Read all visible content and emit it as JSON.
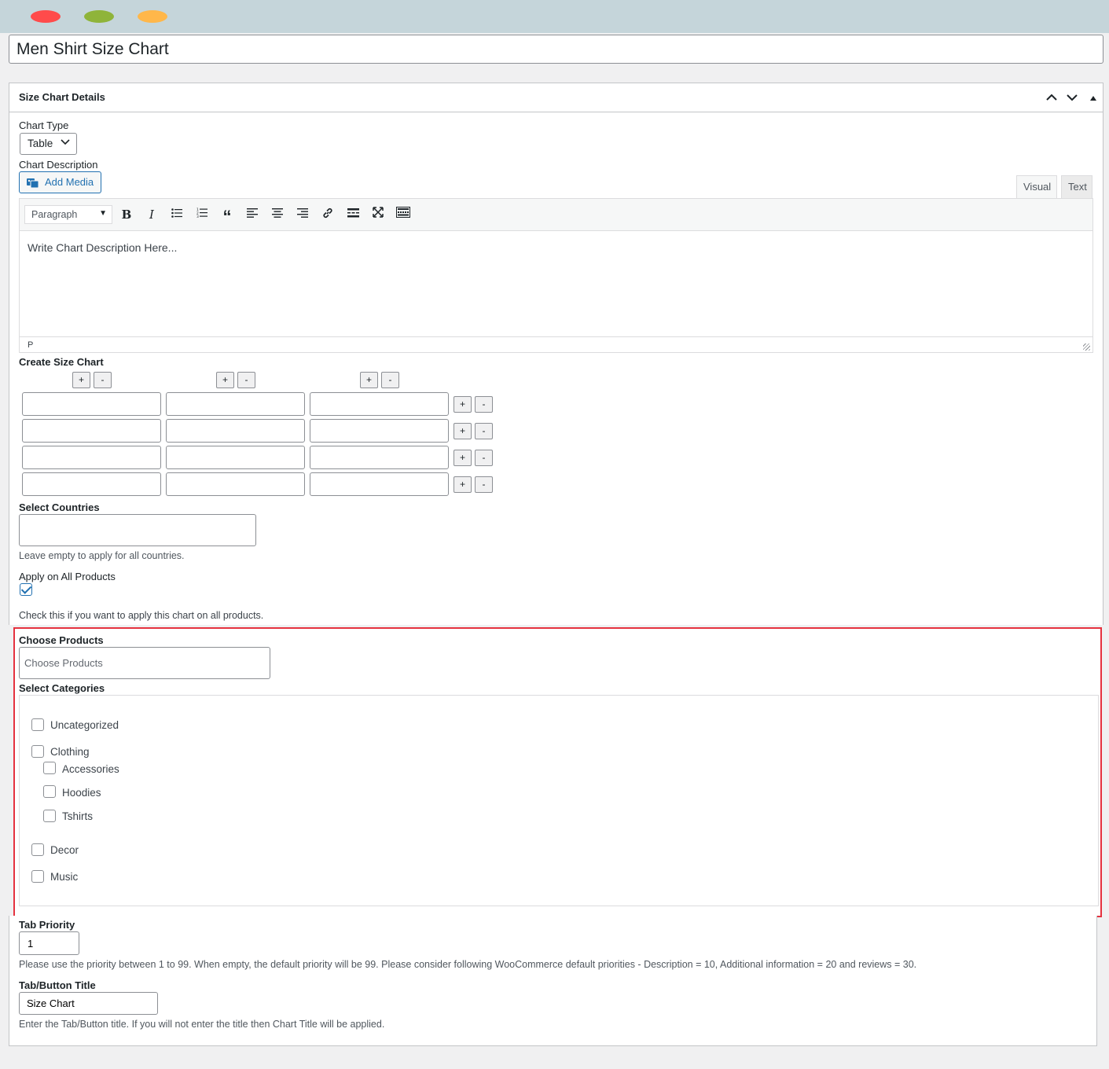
{
  "window": {
    "controls": [
      "close",
      "minimize",
      "maximize"
    ]
  },
  "post_title": "Men Shirt Size Chart",
  "metabox": {
    "title": "Size Chart Details",
    "header_buttons": [
      "chevron-up-icon",
      "chevron-down-icon",
      "triangle-up-icon"
    ]
  },
  "chart_type": {
    "label": "Chart Type",
    "selected": "Table"
  },
  "chart_description": {
    "label": "Chart Description",
    "add_media_label": "Add Media",
    "tabs": {
      "visual": "Visual",
      "text": "Text"
    },
    "format_select": "Paragraph",
    "toolbar_icons": [
      "bold-icon",
      "italic-icon",
      "bullet-list-icon",
      "numbered-list-icon",
      "blockquote-icon",
      "align-left-icon",
      "align-center-icon",
      "align-right-icon",
      "link-icon",
      "read-more-icon",
      "fullscreen-icon",
      "toolbar-toggle-icon"
    ],
    "content": "Write Chart Description Here...",
    "path": "P"
  },
  "size_chart": {
    "label": "Create Size Chart",
    "columns": 3,
    "rows": [
      [
        "",
        "",
        ""
      ],
      [
        "",
        "",
        ""
      ],
      [
        "",
        "",
        ""
      ],
      [
        "",
        "",
        ""
      ]
    ],
    "plus": "+",
    "minus": "-"
  },
  "countries": {
    "label": "Select Countries",
    "value": "",
    "help": "Leave empty to apply for all countries."
  },
  "apply_all": {
    "label": "Apply on All Products",
    "checked": true,
    "help": "Check this if you want to apply this chart on all products."
  },
  "choose_products": {
    "label": "Choose Products",
    "placeholder": "Choose Products"
  },
  "categories": {
    "label": "Select Categories",
    "items": [
      {
        "label": "Uncategorized",
        "checked": false
      },
      {
        "label": "Clothing",
        "checked": false
      },
      {
        "label": "Accessories",
        "checked": false
      },
      {
        "label": "Hoodies",
        "checked": false
      },
      {
        "label": "Tshirts",
        "checked": false
      },
      {
        "label": "Decor",
        "checked": false
      },
      {
        "label": "Music",
        "checked": false
      }
    ]
  },
  "tab_priority": {
    "label": "Tab Priority",
    "value": "1",
    "help": "Please use the priority between 1 to 99. When empty, the default priority will be 99. Please consider following WooCommerce default priorities - Description = 10, Additional information = 20 and reviews = 30."
  },
  "tab_title": {
    "label": "Tab/Button Title",
    "value": "Size Chart",
    "help": "Enter the Tab/Button title. If you will not enter the title then Chart Title will be applied."
  },
  "colors": {
    "titlebar": "#c5d5da",
    "close": "#ff4b4b",
    "minimize": "#8fb43a",
    "maximize": "#ffb74a",
    "highlight": "#e5323f",
    "accent": "#2271b1"
  }
}
